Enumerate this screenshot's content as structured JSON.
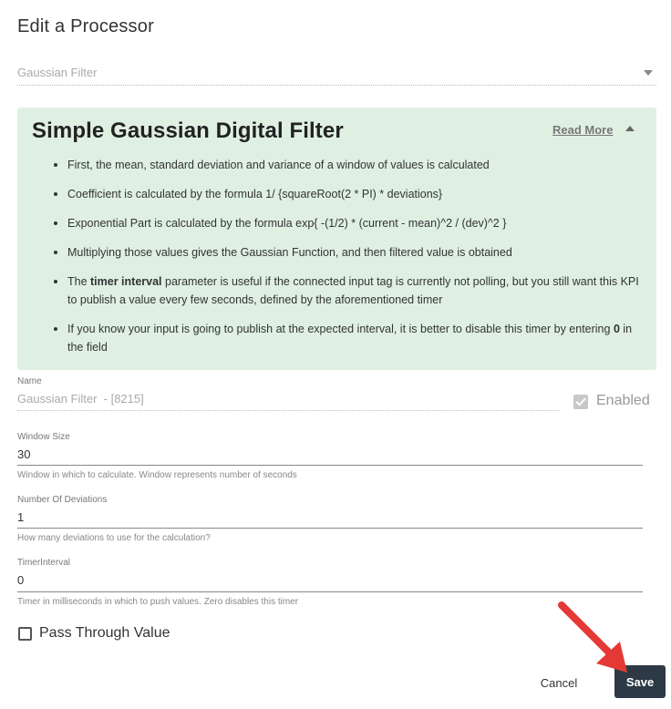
{
  "dialog": {
    "title": "Edit a Processor"
  },
  "processor_type": {
    "value": "Gaussian Filter"
  },
  "info": {
    "heading": "Simple Gaussian Digital Filter",
    "read_more": "Read More",
    "bullets": [
      "First, the mean, standard deviation and variance of a window of values is calculated",
      "Coefficient is calculated by the formula 1/ {squareRoot(2 * PI) * deviations}",
      "Exponential Part is calculated by the formula exp{ -(1/2) * (current - mean)^2 / (dev)^2 }",
      "Multiplying those values gives the Gaussian Function, and then filtered value is obtained"
    ],
    "timer_note": {
      "prefix": "The ",
      "bold": "timer interval",
      "suffix": " parameter is useful if the connected input tag is currently not polling, but you still want this KPI to publish a value every few seconds, defined by the aforementioned timer"
    },
    "disable_note": {
      "prefix": "If you know your input is going to publish at the expected interval, it is better to disable this timer by entering ",
      "bold": "0",
      "suffix": " in the field"
    }
  },
  "name_field": {
    "label": "Name",
    "value": "Gaussian Filter  - [8215]"
  },
  "enabled": {
    "label": "Enabled",
    "checked": true
  },
  "window_size": {
    "label": "Window Size",
    "value": "30",
    "help": "Window in which to calculate. Window represents number of seconds"
  },
  "deviations": {
    "label": "Number Of Deviations",
    "value": "1",
    "help": "How many deviations to use for the calculation?"
  },
  "timer_interval": {
    "label": "TimerInterval",
    "value": "0",
    "help": "Timer in milliseconds in which to push values. Zero disables this timer"
  },
  "pass_through": {
    "label": "Pass Through Value",
    "checked": false
  },
  "actions": {
    "cancel": "Cancel",
    "save": "Save"
  },
  "colors": {
    "panel_bg": "#dff0e3",
    "save_bg": "#2d3a45",
    "arrow": "#e53935"
  },
  "icons": {
    "type_select": "chevron-down-icon",
    "collapse": "chevron-up-icon",
    "check": "check-icon"
  }
}
